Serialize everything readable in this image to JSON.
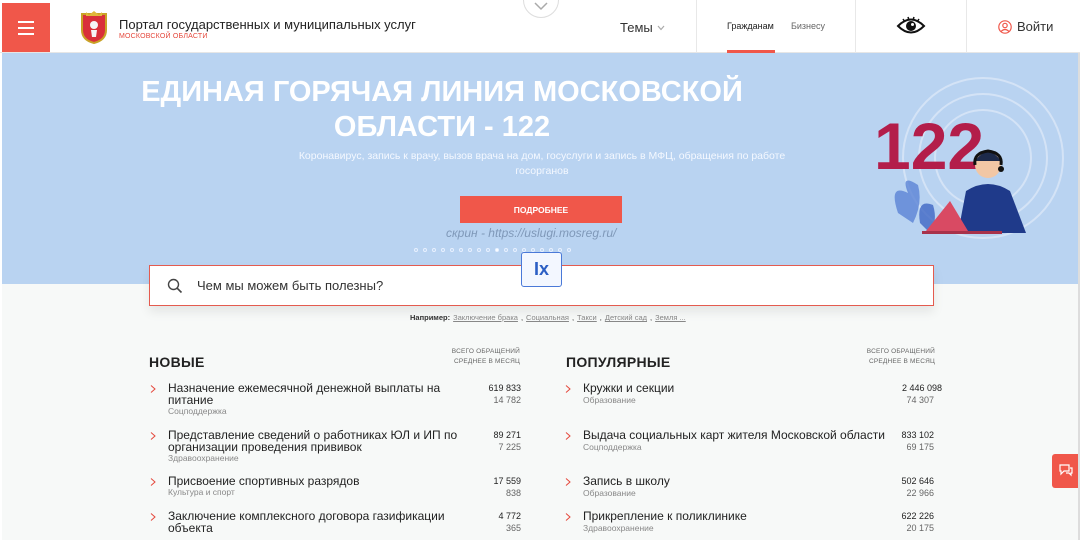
{
  "header": {
    "portal_title": "Портал государственных и муниципальных услуг",
    "region": "МОСКОВСКОЙ ОБЛАСТИ",
    "themes_label": "Темы",
    "tab_citizens": "Гражданам",
    "tab_business": "Бизнесу",
    "login_label": "Войти"
  },
  "hero": {
    "title": "ЕДИНАЯ ГОРЯЧАЯ ЛИНИЯ МОСКОВСКОЙ ОБЛАСТИ - 122",
    "subtitle": "Коронавирус, запись к врачу, вызов врача на дом, госуслуги и запись в МФЦ, обращения по работе госорганов",
    "button": "ПОДРОБНЕЕ",
    "watermark": "скрин - https://uslugi.mosreg.ru/",
    "art_number": "122",
    "slides_count": 18,
    "active_slide": 9
  },
  "ix_badge": "Ix",
  "search": {
    "placeholder": "Чем мы можем быть полезны?",
    "examples_label": "Например:",
    "examples": [
      "Заключение брака",
      "Социальная",
      "Такси",
      "Детский сад",
      "Земля ..."
    ]
  },
  "new_services": {
    "title": "НОВЫЕ",
    "meta_line1": "ВСЕГО ОБРАЩЕНИЙ",
    "meta_line2": "СРЕДНЕЕ В МЕСЯЦ",
    "items": [
      {
        "name_line1": "Назначение ежемесячной денежной выплаты на",
        "name_line2": "питание",
        "category": "Соцподдержка",
        "total": "619 833",
        "avg": "14 782"
      },
      {
        "name_line1": "Представление сведений о работниках ЮЛ и ИП по",
        "name_line2": "организации проведения прививок",
        "category": "Здравоохранение",
        "total": "89 271",
        "avg": "7 225"
      },
      {
        "name_line1": "Присвоение спортивных разрядов",
        "name_line2": "",
        "category": "Культура и спорт",
        "total": "17 559",
        "avg": "838"
      },
      {
        "name_line1": "Заключение комплексного договора газификации",
        "name_line2": "объекта",
        "category": "",
        "total": "4 772",
        "avg": "365"
      }
    ]
  },
  "popular_services": {
    "title": "ПОПУЛЯРНЫЕ",
    "meta_line1": "ВСЕГО ОБРАЩЕНИЙ",
    "meta_line2": "СРЕДНЕЕ В МЕСЯЦ",
    "items": [
      {
        "name_line1": "Кружки и секции",
        "category": "Образование",
        "total": "2 446 098",
        "avg": "74 307"
      },
      {
        "name_line1": "Выдача социальных карт жителя Московской области",
        "category": "Соцподдержка",
        "total": "833 102",
        "avg": "69 175"
      },
      {
        "name_line1": "Запись в школу",
        "category": "Образование",
        "total": "502 646",
        "avg": "22 966"
      },
      {
        "name_line1": "Прикрепление к поликлинике",
        "category": "Здравоохранение",
        "total": "622 226",
        "avg": "20 175"
      }
    ]
  },
  "colors": {
    "accent": "#f0574a",
    "hero_bg": "#b9d3f1",
    "art_number": "#b31d4a"
  }
}
